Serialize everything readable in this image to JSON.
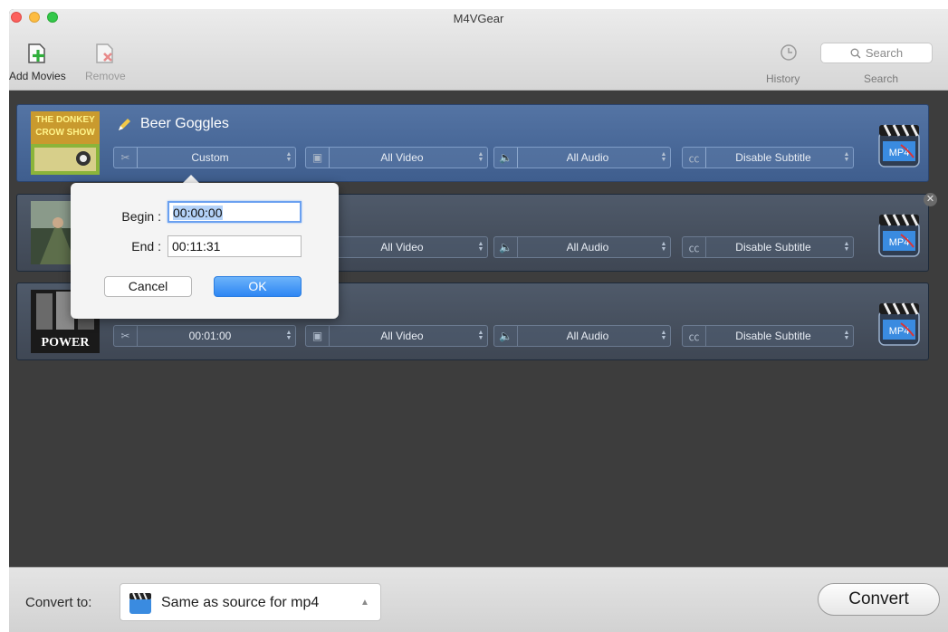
{
  "window": {
    "title": "M4VGear"
  },
  "toolbar": {
    "add_movies": "Add Movies",
    "remove": "Remove",
    "history": "History",
    "search_label": "Search",
    "search_placeholder": "Search"
  },
  "movies": [
    {
      "title": "Beer Goggles",
      "cut": "Custom",
      "video": "All Video",
      "audio": "All Audio",
      "subtitle": "Disable Subtitle",
      "format_icon": "MP4"
    },
    {
      "title": "",
      "cut": "",
      "video": "All Video",
      "audio": "All Audio",
      "subtitle": "Disable Subtitle",
      "format_icon": "MP4"
    },
    {
      "title": "",
      "cut": "00:01:00",
      "video": "All Video",
      "audio": "All Audio",
      "subtitle": "Disable Subtitle",
      "format_icon": "MP4"
    }
  ],
  "thumbs": {
    "t1_lines": [
      "THE DONKEY",
      "CROW SHOW"
    ],
    "t3_text": "POWER"
  },
  "popover": {
    "begin_label": "Begin :",
    "begin_value": "00:00:00",
    "end_label": "End :",
    "end_value": "00:11:31",
    "cancel": "Cancel",
    "ok": "OK"
  },
  "bottom": {
    "convert_to_label": "Convert to:",
    "format": "Same as source for mp4",
    "convert": "Convert"
  },
  "colors": {
    "selected_row": "#4a6a9c",
    "row": "#4a5360",
    "ok_button": "#2e86f3"
  }
}
